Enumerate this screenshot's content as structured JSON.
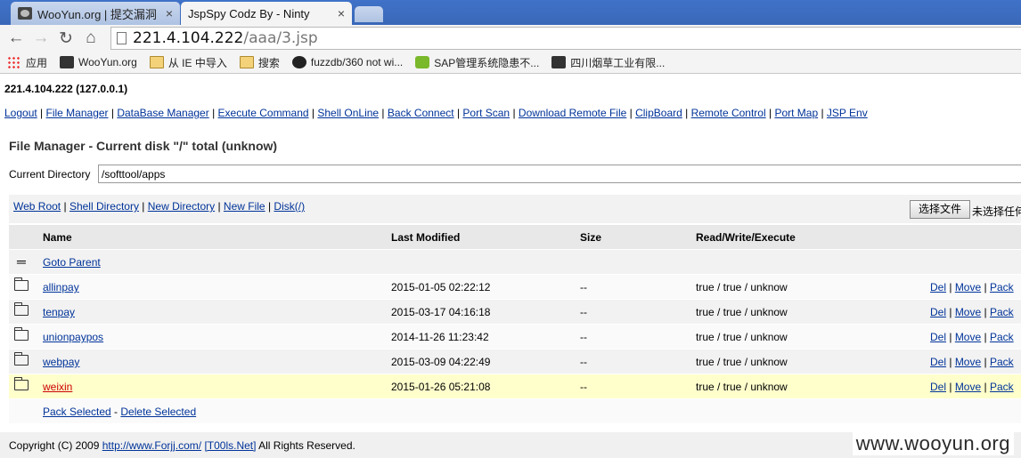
{
  "browser": {
    "tabs": [
      {
        "title": "WooYun.org | 提交漏洞",
        "close": "×"
      },
      {
        "title": "JspSpy Codz By - Ninty",
        "close": "×"
      }
    ],
    "url_host": "221.4.104.222",
    "url_path": "/aaa/3.jsp",
    "bookmarks": [
      "应用",
      "WooYun.org",
      "从 IE 中导入",
      "搜索",
      "fuzzdb/360 not wi...",
      "SAP管理系统隐患不...",
      "四川烟草工业有限..."
    ]
  },
  "page": {
    "host_line": "221.4.104.222 (127.0.0.1)",
    "main_nav": [
      "Logout",
      "File Manager",
      "DataBase Manager",
      "Execute Command",
      "Shell OnLine",
      "Back Connect",
      "Port Scan",
      "Download Remote File",
      "ClipBoard",
      "Remote Control",
      "Port Map",
      "JSP Env"
    ],
    "panel_title": "File Manager - Current disk \"/\" total (unknow)",
    "current_dir_label": "Current Directory",
    "current_dir_value": "/softtool/apps",
    "action_links": [
      "Web Root",
      "Shell Directory",
      "New Directory",
      "New File",
      "Disk(/)"
    ],
    "file_button": "选择文件",
    "no_file_text": "未选择任何文件",
    "columns": {
      "name": "Name",
      "modified": "Last Modified",
      "size": "Size",
      "rwx": "Read/Write/Execute"
    },
    "goto_parent": "Goto Parent",
    "rows": [
      {
        "name": "allinpay",
        "modified": "2015-01-05 02:22:12",
        "size": "--",
        "rwx": "true / true / unknow"
      },
      {
        "name": "tenpay",
        "modified": "2015-03-17 04:16:18",
        "size": "--",
        "rwx": "true / true / unknow"
      },
      {
        "name": "unionpaypos",
        "modified": "2014-11-26 11:23:42",
        "size": "--",
        "rwx": "true / true / unknow"
      },
      {
        "name": "webpay",
        "modified": "2015-03-09 04:22:49",
        "size": "--",
        "rwx": "true / true / unknow"
      },
      {
        "name": "weixin",
        "modified": "2015-01-26 05:21:08",
        "size": "--",
        "rwx": "true / true / unknow"
      }
    ],
    "ops": [
      "Del",
      "Move",
      "Pack"
    ],
    "bulk_pack": "Pack Selected",
    "bulk_delete": "Delete Selected",
    "footer_prefix": "Copyright (C) 2009",
    "footer_link1": "http://www.Forjj.com/",
    "footer_link2": "[T00ls.Net]",
    "footer_suffix": "All Rights Reserved.",
    "watermark": "www.wooyun.org"
  },
  "colors": {
    "link": "#003399",
    "highlight_row": "#ffffcc",
    "highlight_text": "#cc0000"
  }
}
